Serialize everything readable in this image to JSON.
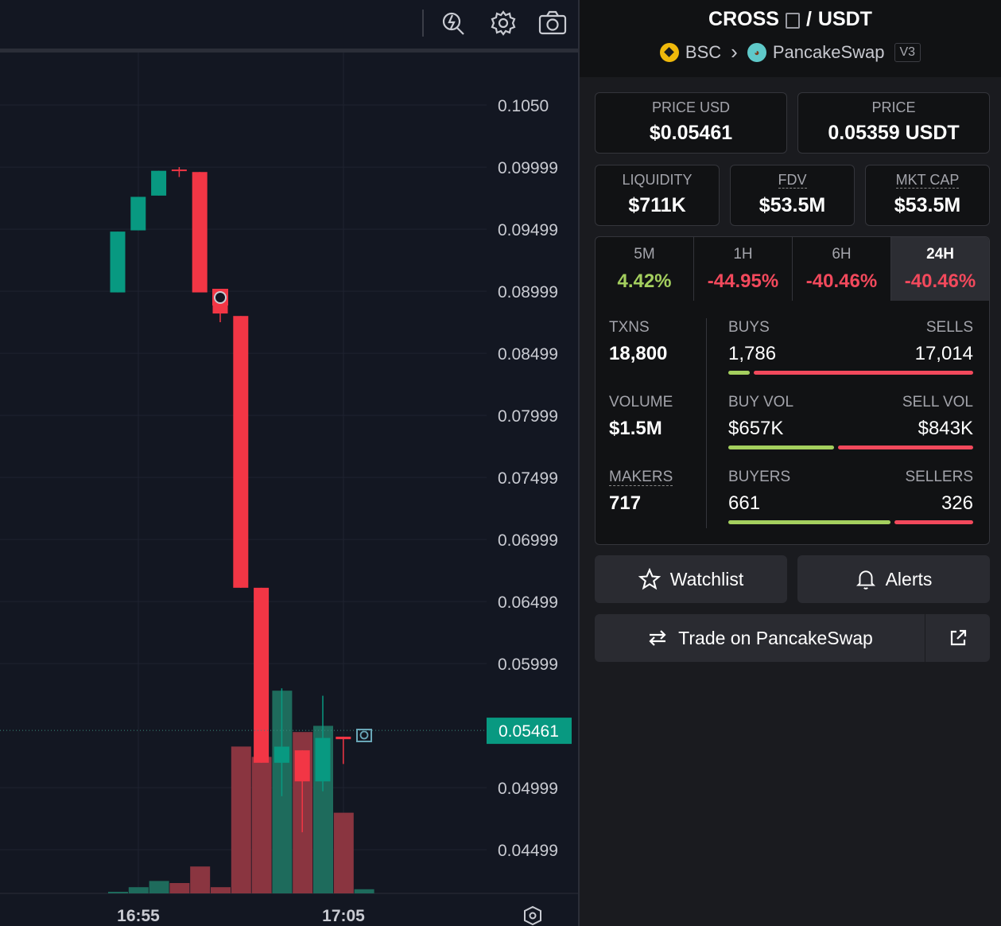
{
  "chart": {
    "price_axis_labels": [
      "0.1050",
      "0.09999",
      "0.09499",
      "0.08999",
      "0.08499",
      "0.07999",
      "0.07499",
      "0.06999",
      "0.06499",
      "0.05999",
      "0.04999",
      "0.04499"
    ],
    "current_price_label": "0.05461",
    "time_labels": [
      "16:55",
      "17:05"
    ],
    "colors": {
      "up": "#089981",
      "down": "#f23645",
      "up_volume": "#1e6b5c",
      "down_volume": "#8a3540",
      "price_badge": "#089981"
    }
  },
  "chart_data": {
    "type": "candlestick",
    "ylim": [
      0.0425,
      0.1075
    ],
    "y_ticks": [
      0.105,
      0.09999,
      0.09499,
      0.08999,
      0.08499,
      0.07999,
      0.07499,
      0.06999,
      0.06499,
      0.05999,
      0.04999,
      0.04499
    ],
    "x_ticks": [
      "16:55",
      "17:05"
    ],
    "last_price": 0.05461,
    "candles": [
      {
        "open": 0.0899,
        "high": 0.0948,
        "low": 0.0899,
        "close": 0.0948
      },
      {
        "open": 0.0949,
        "high": 0.0976,
        "low": 0.0949,
        "close": 0.0976
      },
      {
        "open": 0.0977,
        "high": 0.0997,
        "low": 0.0977,
        "close": 0.0997
      },
      {
        "open": 0.0998,
        "high": 0.1,
        "low": 0.0992,
        "close": 0.0997
      },
      {
        "open": 0.0996,
        "high": 0.0996,
        "low": 0.0899,
        "close": 0.0899
      },
      {
        "open": 0.089,
        "high": 0.0894,
        "low": 0.0875,
        "close": 0.0882
      },
      {
        "open": 0.088,
        "high": 0.088,
        "low": 0.0661,
        "close": 0.0661
      },
      {
        "open": 0.0661,
        "high": 0.0661,
        "low": 0.052,
        "close": 0.052
      },
      {
        "open": 0.052,
        "high": 0.058,
        "low": 0.0493,
        "close": 0.0533
      },
      {
        "open": 0.053,
        "high": 0.053,
        "low": 0.0464,
        "close": 0.0505
      },
      {
        "open": 0.0505,
        "high": 0.0574,
        "low": 0.0497,
        "close": 0.054
      },
      {
        "open": 0.0541,
        "high": 0.0541,
        "low": 0.0519,
        "close": 0.0539
      }
    ],
    "volume": [
      0,
      3,
      6,
      5,
      13,
      3,
      71,
      66,
      98,
      78,
      81,
      39,
      2
    ]
  },
  "pair": {
    "base": "CROSS",
    "separator": "/",
    "quote": "USDT",
    "chain": "BSC",
    "chevron": "›",
    "dex": "PancakeSwap",
    "version": "V3"
  },
  "prices": {
    "usd_label": "PRICE USD",
    "usd_value": "$0.05461",
    "native_label": "PRICE",
    "native_value": "0.05359 USDT"
  },
  "metrics": [
    {
      "label": "LIQUIDITY",
      "value": "$711K"
    },
    {
      "label": "FDV",
      "value": "$53.5M"
    },
    {
      "label": "MKT CAP",
      "value": "$53.5M"
    }
  ],
  "timeframes": [
    {
      "label": "5M",
      "value": "4.42%"
    },
    {
      "label": "1H",
      "value": "-44.95%"
    },
    {
      "label": "6H",
      "value": "-40.46%"
    },
    {
      "label": "24H",
      "value": "-40.46%"
    }
  ],
  "stats": {
    "txns_label": "TXNS",
    "txns_value": "18,800",
    "buys_label": "BUYS",
    "buys_value": "1,786",
    "sells_label": "SELLS",
    "sells_value": "17,014",
    "buys_ratio": 0.095,
    "volume_label": "VOLUME",
    "volume_value": "$1.5M",
    "buy_vol_label": "BUY VOL",
    "buy_vol_value": "$657K",
    "sell_vol_label": "SELL VOL",
    "sell_vol_value": "$843K",
    "buy_vol_ratio": 0.438,
    "makers_label": "MAKERS",
    "makers_value": "717",
    "buyers_label": "BUYERS",
    "buyers_value": "661",
    "sellers_label": "SELLERS",
    "sellers_value": "326",
    "buyers_ratio": 0.67
  },
  "actions": {
    "watchlist_label": "Watchlist",
    "alerts_label": "Alerts",
    "trade_label": "Trade on PancakeSwap"
  },
  "icons": {
    "toolbar": [
      "indicator-search-icon",
      "settings-gear-icon",
      "camera-icon"
    ],
    "axis": "settings-hexagon-icon",
    "watchlist": "star-icon",
    "alerts": "bell-icon",
    "trade": "swap-arrows-icon",
    "external": "external-link-icon"
  }
}
